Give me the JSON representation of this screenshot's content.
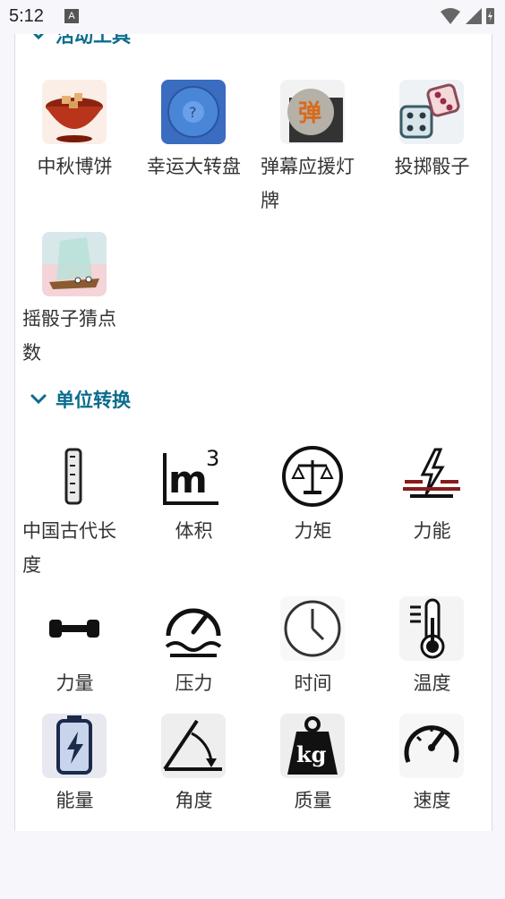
{
  "status": {
    "time": "5:12",
    "notif_letter": "A"
  },
  "sections": {
    "activity": {
      "title": "活动工具"
    },
    "unit": {
      "title": "单位转换"
    }
  },
  "activity_tools": [
    {
      "label": "中秋博饼",
      "icon": "mooncake-bowl-icon"
    },
    {
      "label": "幸运大转盘",
      "icon": "lucky-wheel-icon"
    },
    {
      "label": "弹幕应援灯牌",
      "icon": "danmaku-icon"
    },
    {
      "label": "投掷骰子",
      "icon": "dice-icon"
    },
    {
      "label": "摇骰子猜点数",
      "icon": "dice-cup-icon"
    }
  ],
  "unit_tools": [
    {
      "label": "中国古代长度",
      "icon": "ruler-icon"
    },
    {
      "label": "体积",
      "icon": "cubic-meter-icon"
    },
    {
      "label": "力矩",
      "icon": "balance-scale-icon"
    },
    {
      "label": "力能",
      "icon": "energy-bolt-icon"
    },
    {
      "label": "力量",
      "icon": "dumbbell-icon"
    },
    {
      "label": "压力",
      "icon": "pressure-gauge-icon"
    },
    {
      "label": "时间",
      "icon": "clock-icon"
    },
    {
      "label": "温度",
      "icon": "thermometer-icon"
    },
    {
      "label": "能量",
      "icon": "battery-icon"
    },
    {
      "label": "角度",
      "icon": "angle-icon"
    },
    {
      "label": "质量",
      "icon": "kg-weight-icon"
    },
    {
      "label": "速度",
      "icon": "speedometer-icon"
    }
  ]
}
